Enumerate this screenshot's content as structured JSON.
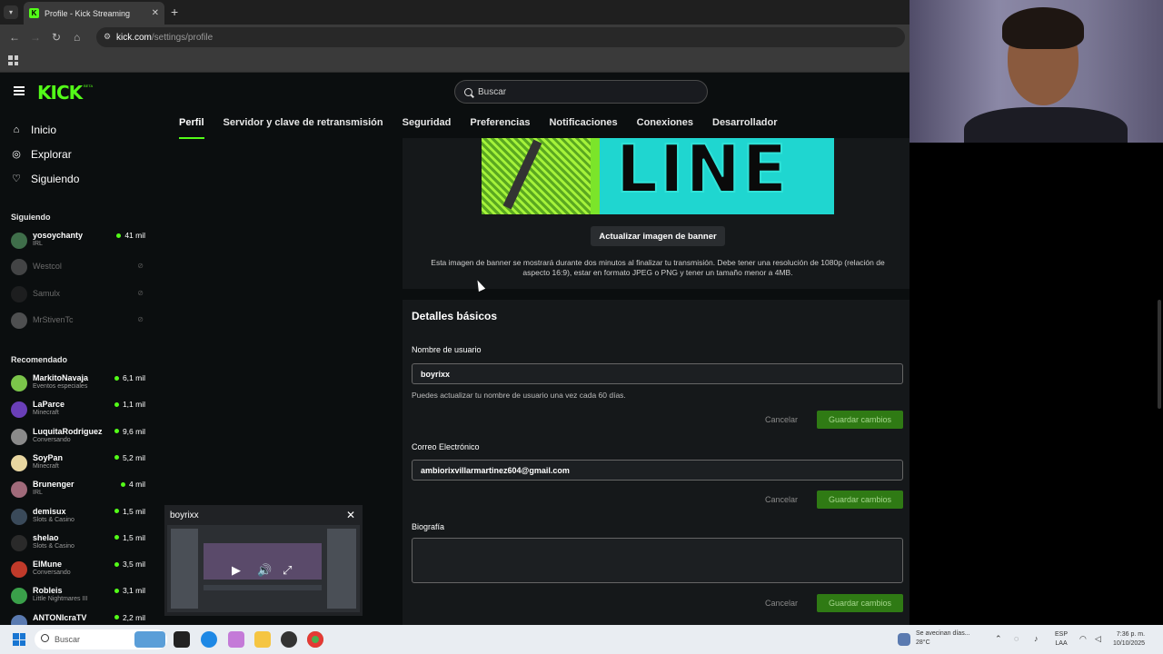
{
  "browser": {
    "tab_title": "Profile - Kick Streaming",
    "url_domain": "kick.com",
    "url_path": "/settings/profile"
  },
  "kick": {
    "logo": "KICK",
    "logo_badge": "BETA",
    "search_placeholder": "Buscar",
    "settings_tabs": [
      "Perfil",
      "Servidor y clave de retransmisión",
      "Seguridad",
      "Preferencias",
      "Notificaciones",
      "Conexiones",
      "Desarrollador"
    ],
    "active_tab": "Perfil"
  },
  "sidebar": {
    "nav": [
      {
        "label": "Inicio",
        "icon": "home-icon"
      },
      {
        "label": "Explorar",
        "icon": "compass-icon"
      },
      {
        "label": "Siguiendo",
        "icon": "heart-icon"
      }
    ],
    "following_header": "Siguiendo",
    "following": [
      {
        "name": "yosoychanty",
        "sub": "IRL",
        "viewers": "41 mil",
        "live": true,
        "color": "#3f6e4a"
      },
      {
        "name": "Westcol",
        "sub": "",
        "viewers": "",
        "live": false,
        "color": "#888888"
      },
      {
        "name": "Samulx",
        "sub": "",
        "viewers": "",
        "live": false,
        "color": "#333333"
      },
      {
        "name": "MrStivenTc",
        "sub": "",
        "viewers": "",
        "live": false,
        "color": "#a0a0a0"
      }
    ],
    "recommended_header": "Recomendado",
    "recommended": [
      {
        "name": "MarkitoNavaja",
        "sub": "Eventos especiales",
        "viewers": "6,1 mil",
        "color": "#7bc44a"
      },
      {
        "name": "LaParce",
        "sub": "Minecraft",
        "viewers": "1,1 mil",
        "color": "#6a3fb8"
      },
      {
        "name": "LuquitaRodriguez",
        "sub": "Conversando",
        "viewers": "9,6 mil",
        "color": "#8a8a8a"
      },
      {
        "name": "SoyPan",
        "sub": "Minecraft",
        "viewers": "5,2 mil",
        "color": "#e8d6a0"
      },
      {
        "name": "Brunenger",
        "sub": "IRL",
        "viewers": "4 mil",
        "color": "#a06a7a"
      },
      {
        "name": "demisux",
        "sub": "Slots & Casino",
        "viewers": "1,5 mil",
        "color": "#3a4a5a"
      },
      {
        "name": "shelao",
        "sub": "Slots & Casino",
        "viewers": "1,5 mil",
        "color": "#2a2a2a"
      },
      {
        "name": "ElMune",
        "sub": "Conversando",
        "viewers": "3,5 mil",
        "color": "#c03a2a"
      },
      {
        "name": "Robleis",
        "sub": "Little Nightmares III",
        "viewers": "3,1 mil",
        "color": "#3aa04a"
      },
      {
        "name": "ANTONIcraTV",
        "sub": "",
        "viewers": "2,2 mil",
        "color": "#5a7ab0"
      }
    ]
  },
  "banner": {
    "text": "LINE",
    "button": "Actualizar imagen de banner",
    "note": "Esta imagen de banner se mostrará durante dos minutos al finalizar tu transmisión. Debe tener una resolución de 1080p (relación de aspecto 16:9), estar en formato JPEG o PNG y tener un tamaño menor a 4MB."
  },
  "details": {
    "title": "Detalles básicos",
    "username_label": "Nombre de usuario",
    "username_value": "boyrixx",
    "username_hint": "Puedes actualizar tu nombre de usuario una vez cada 60 días.",
    "email_label": "Correo Electrónico",
    "email_value": "ambiorixvillarmartinez604@gmail.com",
    "bio_label": "Biografía",
    "cancel": "Cancelar",
    "save": "Guardar cambios"
  },
  "mini_player": {
    "title": "boyrixx"
  },
  "taskbar": {
    "search": "Buscar",
    "weather_line1": "Se avecinan días...",
    "weather_line2": "28°C",
    "lang_line1": "ESP",
    "lang_line2": "LAA",
    "time": "7:36 p. m.",
    "date": "10/10/2025"
  }
}
